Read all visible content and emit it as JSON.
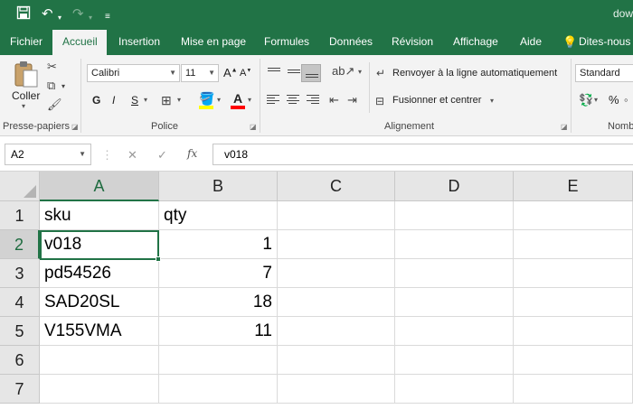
{
  "title_bar": {
    "document_title": "dow"
  },
  "tabs": [
    {
      "label": "Fichier"
    },
    {
      "label": "Accueil"
    },
    {
      "label": "Insertion"
    },
    {
      "label": "Mise en page"
    },
    {
      "label": "Formules"
    },
    {
      "label": "Données"
    },
    {
      "label": "Révision"
    },
    {
      "label": "Affichage"
    },
    {
      "label": "Aide"
    },
    {
      "label": "Dites-nous c"
    }
  ],
  "active_tab": "Accueil",
  "ribbon": {
    "paste_label": "Coller",
    "clipboard_group": "Presse-papiers",
    "font_group": "Police",
    "font_name": "Calibri",
    "font_size": "11",
    "bold": "G",
    "italic": "I",
    "underline": "S",
    "grow_font": "A",
    "shrink_font": "A",
    "font_color_letter": "A",
    "alignment_group": "Alignement",
    "wrap_text_label": "Renvoyer à la ligne automatiquement",
    "merge_center_label": "Fusionner et centrer",
    "number_format": "Standard",
    "percent": "%",
    "number_group": "Nomb",
    "fill_color": "#ffff00",
    "font_color": "#ff0000"
  },
  "formula_bar": {
    "name_box": "A2",
    "fx_label": "fx",
    "formula_value": "v018"
  },
  "sheet": {
    "columns": [
      "A",
      "B",
      "C",
      "D",
      "E"
    ],
    "active_column": "A",
    "active_row": "2",
    "rows": [
      {
        "num": "1",
        "cells": [
          "sku",
          "qty",
          "",
          "",
          ""
        ]
      },
      {
        "num": "2",
        "cells": [
          "v018",
          "1",
          "",
          "",
          ""
        ]
      },
      {
        "num": "3",
        "cells": [
          "pd54526",
          "7",
          "",
          "",
          ""
        ]
      },
      {
        "num": "4",
        "cells": [
          "SAD20SL",
          "18",
          "",
          "",
          ""
        ]
      },
      {
        "num": "5",
        "cells": [
          "V155VMA",
          "11",
          "",
          "",
          ""
        ]
      },
      {
        "num": "6",
        "cells": [
          "",
          "",
          "",
          "",
          ""
        ]
      },
      {
        "num": "7",
        "cells": [
          "",
          "",
          "",
          "",
          ""
        ]
      }
    ],
    "selected_cell": "A2",
    "accent_color": "#217346"
  }
}
